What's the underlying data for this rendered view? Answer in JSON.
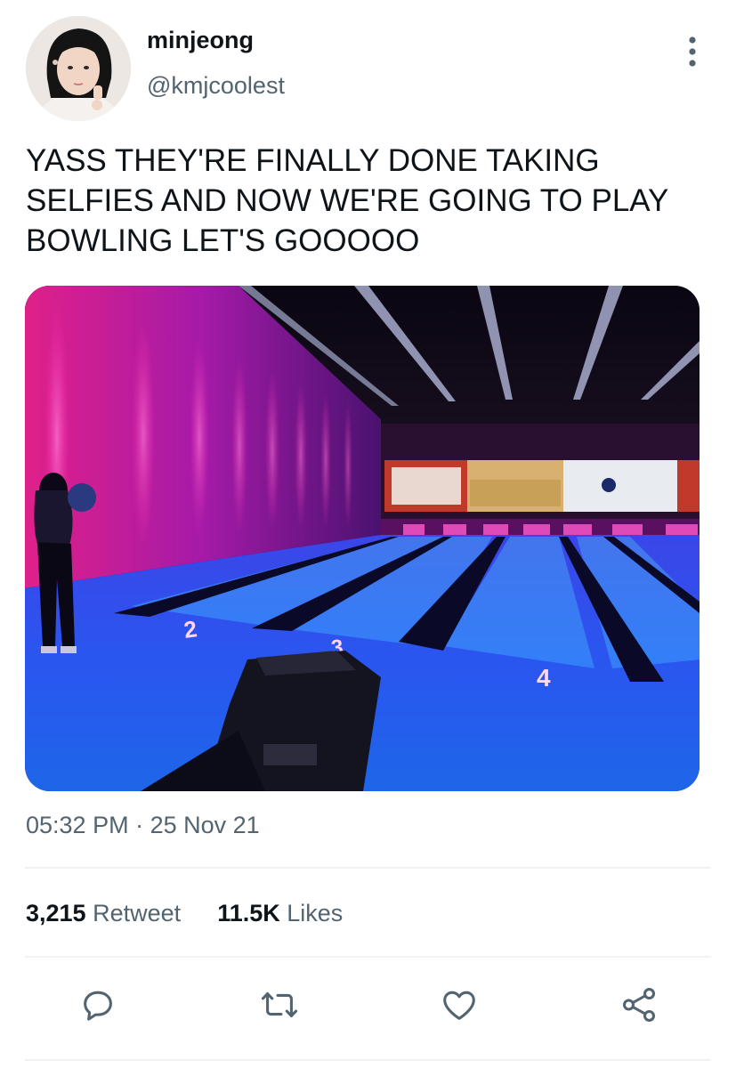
{
  "user": {
    "display_name": "minjeong",
    "handle": "@kmjcoolest"
  },
  "tweet": {
    "lines": [
      "YASS THEY'RE FINALLY DONE TAKING",
      "SELFIES AND NOW WE'RE GOING TO PLAY",
      "BOWLING LET'S GOOOOO"
    ],
    "time": "05:32 PM",
    "separator": "·",
    "date": "25 Nov 21"
  },
  "media": {
    "lane_numbers": [
      "2",
      "3",
      "4"
    ]
  },
  "stats": {
    "retweets_count": "3,215",
    "retweets_label": "Retweet",
    "likes_count": "11.5K",
    "likes_label": "Likes"
  },
  "actions": {
    "icons": [
      "reply-icon",
      "retweet-icon",
      "like-icon",
      "share-icon"
    ]
  },
  "colors": {
    "primary_text": "#0f1419",
    "secondary_text": "#536471",
    "divider": "#eff3f4"
  }
}
